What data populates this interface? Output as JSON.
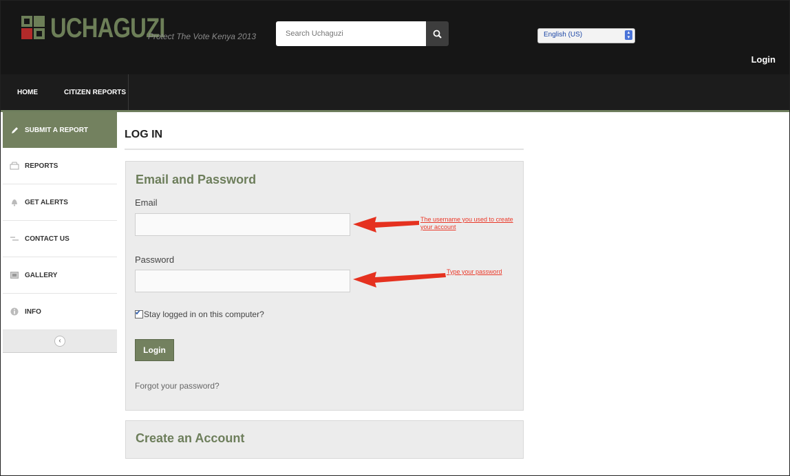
{
  "colors": {
    "brand_green": "#6d7f58",
    "header_bg": "#161616",
    "annotation_red": "#e53222"
  },
  "header": {
    "logo_text": "UCHAGUZI",
    "tagline": "Protect The Vote Kenya 2013",
    "search_placeholder": "Search Uchaguzi",
    "search_icon": "search-icon",
    "language": "English (US)",
    "login_link": "Login"
  },
  "nav": {
    "items": [
      {
        "label": "HOME"
      },
      {
        "label": "CITIZEN REPORTS"
      }
    ]
  },
  "sidebar": {
    "items": [
      {
        "label": "SUBMIT A REPORT",
        "icon": "pencil-icon"
      },
      {
        "label": "REPORTS",
        "icon": "archive-icon"
      },
      {
        "label": "GET ALERTS",
        "icon": "bell-icon"
      },
      {
        "label": "CONTACT US",
        "icon": "mail-icon"
      },
      {
        "label": "GALLERY",
        "icon": "picture-icon"
      },
      {
        "label": "INFO",
        "icon": "info-icon"
      }
    ],
    "collapse_glyph": "‹"
  },
  "main": {
    "page_title": "LOG IN",
    "login_panel": {
      "title": "Email and Password",
      "email_label": "Email",
      "email_value": "",
      "password_label": "Password",
      "password_value": "",
      "remember_label": "Stay logged in on this computer?",
      "remember_checked": true,
      "submit_label": "Login",
      "forgot_label": "Forgot your password?"
    },
    "create_panel": {
      "title": "Create an Account"
    }
  },
  "annotations": {
    "email_note_line1": "The username you used to create",
    "email_note_line2": "your account",
    "password_note": "Type your password"
  }
}
